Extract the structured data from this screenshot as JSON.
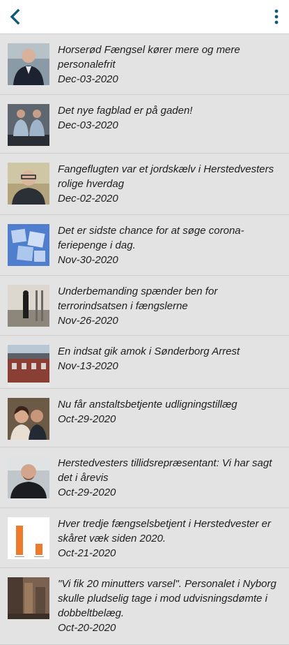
{
  "appbar": {
    "back_icon": "chevron-left-icon",
    "menu_icon": "more-vertical-icon",
    "accent": "#0f5a78"
  },
  "articles": [
    {
      "title": "Horserød Fængsel kører mere og mere personalefrit",
      "date": "Dec-03-2020",
      "thumb": "man-in-dark-suit"
    },
    {
      "title": "Det nye fagblad er på gaden!",
      "date": "Dec-03-2020",
      "thumb": "two-officers"
    },
    {
      "title": "Fangeflugten var et jordskælv i Herstedvesters rolige hverdag",
      "date": "Dec-02-2020",
      "thumb": "man-with-glasses"
    },
    {
      "title": "Det er sidste chance for at søge corona-feriepenge i dag.",
      "date": "Nov-30-2020",
      "thumb": "ice-cubes"
    },
    {
      "title": "Underbemanding spænder ben for terrorindsatsen i fængslerne",
      "date": "Nov-26-2020",
      "thumb": "prison-corridor"
    },
    {
      "title": "En indsat gik amok i Sønderborg Arrest",
      "date": "Nov-13-2020",
      "thumb": "brick-building"
    },
    {
      "title": "Nu får anstaltsbetjente udligningstillæg",
      "date": "Oct-29-2020",
      "thumb": "two-people-smiling"
    },
    {
      "title": "Herstedvesters tillidsrepræsentant: Vi har sagt det i årevis",
      "date": "Oct-29-2020",
      "thumb": "man-in-black-shirt"
    },
    {
      "title": "Hver tredje fængselsbetjent i Herstedvester er skåret væk siden 2020.",
      "date": "Oct-21-2020",
      "thumb": "orange-bar-graphic"
    },
    {
      "title": "\"Vi fik 20 minutters varsel\". Personalet i Nyborg skulle pludselig tage i mod udvisningsdømte i dobbeltbelæg.",
      "date": "Oct-20-2020",
      "thumb": "brick-hallway"
    }
  ]
}
